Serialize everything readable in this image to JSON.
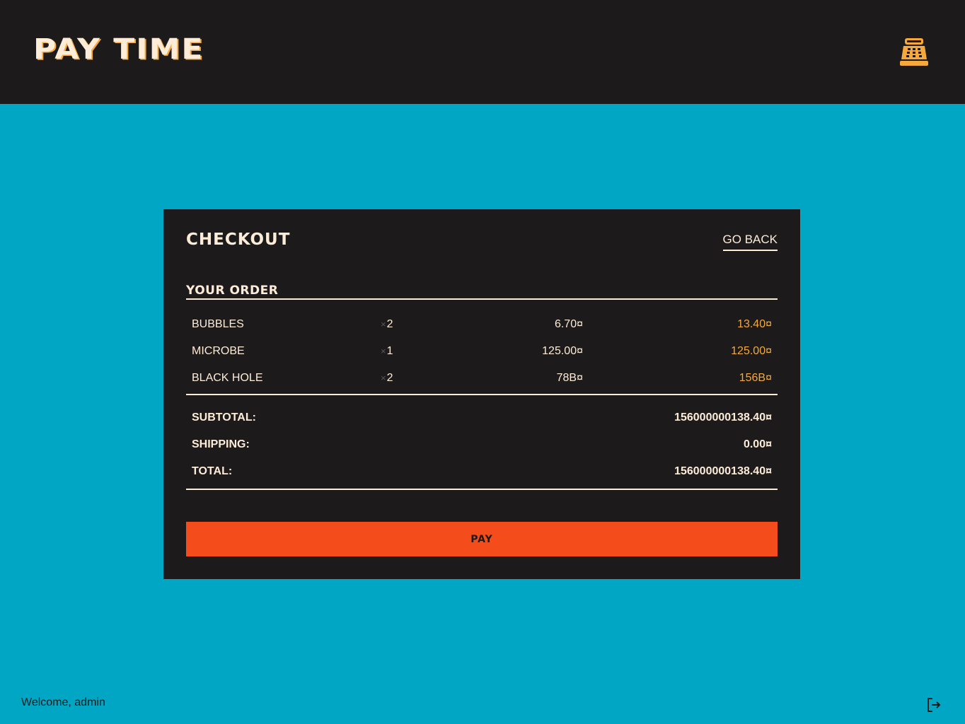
{
  "header": {
    "brand": "PAY TIME",
    "icon": "cash-register-icon"
  },
  "checkout": {
    "title": "CHECKOUT",
    "go_back_label": "GO BACK",
    "section_title": "YOUR ORDER",
    "items": [
      {
        "name": "BUBBLES",
        "qty_prefix": "×",
        "qty": "2",
        "price": "6.70¤",
        "total": "13.40¤"
      },
      {
        "name": "MICROBE",
        "qty_prefix": "×",
        "qty": "1",
        "price": "125.00¤",
        "total": "125.00¤"
      },
      {
        "name": "BLACK HOLE",
        "qty_prefix": "×",
        "qty": "2",
        "price": "78B¤",
        "total": "156B¤"
      }
    ],
    "totals": [
      {
        "label": "SUBTOTAL:",
        "value": "156000000138.40¤"
      },
      {
        "label": "SHIPPING:",
        "value": "0.00¤"
      },
      {
        "label": "TOTAL:",
        "value": "156000000138.40¤"
      }
    ],
    "pay_label": "PAY"
  },
  "footer": {
    "welcome": "Welcome, admin",
    "logout_icon": "logout-icon"
  },
  "colors": {
    "background": "#00a6c4",
    "dark": "#1c1a1b",
    "cream": "#fdecd8",
    "accent": "#f6a93a",
    "pay": "#f44c1a"
  }
}
